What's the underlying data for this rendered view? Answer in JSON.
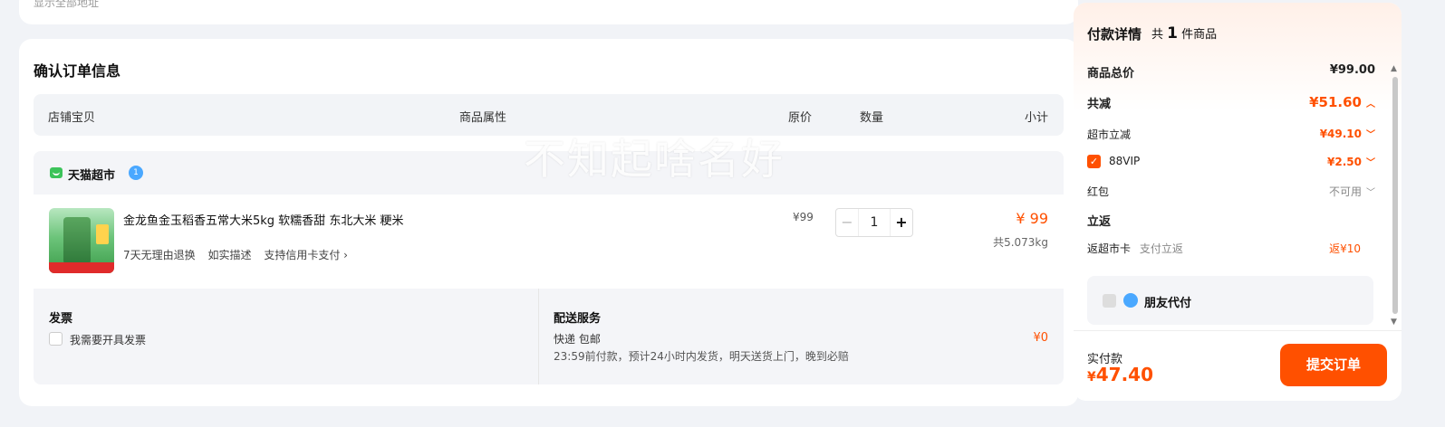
{
  "address_card": {
    "text": "显示全部地址"
  },
  "order": {
    "title": "确认订单信息",
    "columns": {
      "item": "店铺宝贝",
      "attr": "商品属性",
      "price": "原价",
      "qty": "数量",
      "subtotal": "小计"
    },
    "store": {
      "name": "天猫超市",
      "badge": "1"
    },
    "item": {
      "title": "金龙鱼金玉稻香五常大米5kg 软糯香甜 东北大米 粳米",
      "tags": [
        "7天无理由退换",
        "如实描述",
        "支持信用卡支付 ›"
      ],
      "price": "¥99",
      "qty": "1",
      "minus": "−",
      "plus": "+",
      "subtotal": "¥ 99",
      "weight": "共5.073kg"
    },
    "invoice": {
      "title": "发票",
      "checkbox_label": "我需要开具发票"
    },
    "delivery": {
      "title": "配送服务",
      "type": "快递 包邮",
      "desc": "23:59前付款，预计24小时内发货，明天送货上门，晚到必赔",
      "fee": "¥0"
    }
  },
  "watermark": "不知起啥名好",
  "payment": {
    "title": "付款详情",
    "count_prefix": "共",
    "count": "1",
    "count_suffix": "件商品",
    "rows": {
      "total": {
        "label": "商品总价",
        "value": "¥99.00"
      },
      "discount": {
        "label": "共减",
        "value": "¥51.60"
      },
      "supermarket": {
        "label": "超市立减",
        "value": "¥49.10"
      },
      "vip": {
        "label": "88VIP",
        "value": "¥2.50"
      },
      "redpacket": {
        "label": "红包",
        "value": "不可用"
      },
      "rebate_title": {
        "label": "立返"
      },
      "rebate": {
        "label": "返超市卡",
        "sublabel": "支付立返",
        "value": "返¥10"
      }
    },
    "friend_pay": {
      "label": "朋友代付"
    },
    "real_pay": {
      "label": "实付款",
      "currency": "¥",
      "amount": "47.40"
    },
    "submit": {
      "label": "提交订单"
    }
  },
  "colors": {
    "accent": "#ff5000",
    "background": "#f1f3f7"
  }
}
